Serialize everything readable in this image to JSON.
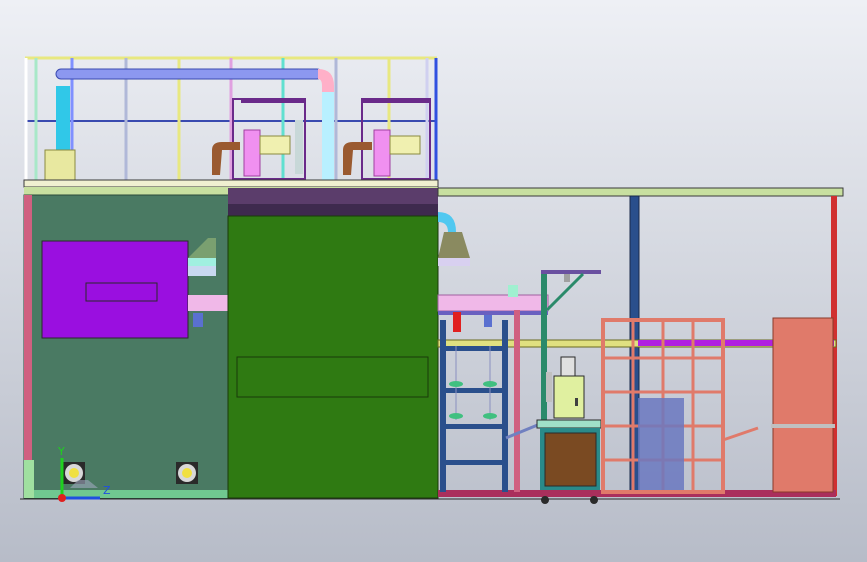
{
  "viewport": {
    "background_top": "#eef0f5",
    "background_bottom": "#b7bcc8"
  },
  "triad": {
    "y_label": "Y",
    "z_label": "Z",
    "y_color": "#1fd01f",
    "z_color": "#1f4fe0",
    "x_color": "#e01f1f"
  },
  "colors": {
    "left_cabinet": "#4a7a63",
    "oven_panel": "#9a0fe0",
    "center_cabinet": "#2f7a12",
    "roof_band": "#5b3d6b",
    "frame_blue": "#2a4f8c",
    "rack_orange": "#e07a6a",
    "brown_box": "#7a4a22",
    "pink_duct": "#f0b8e8",
    "floor_rail": "#aa2f5c"
  }
}
